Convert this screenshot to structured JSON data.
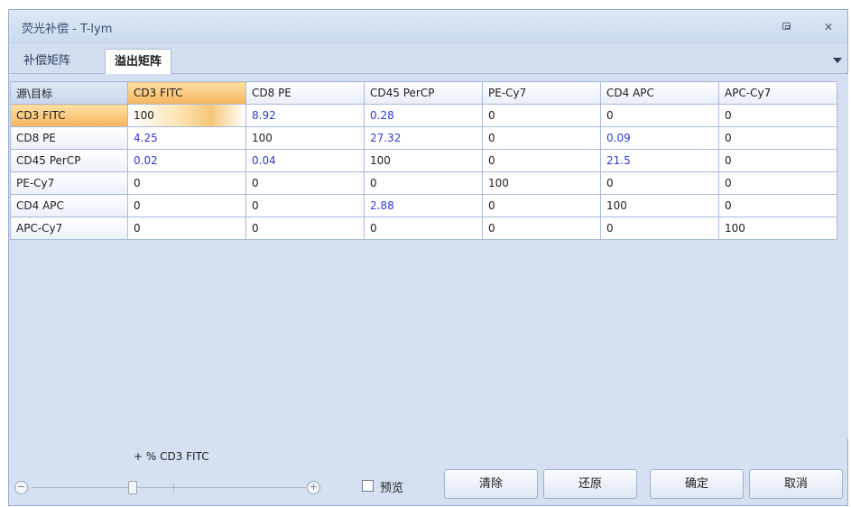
{
  "window": {
    "title": "荧光补偿 - T-lym"
  },
  "tabs": [
    {
      "label": "补偿矩阵"
    },
    {
      "label": "溢出矩阵"
    }
  ],
  "grid": {
    "corner": "源\\目标",
    "columns": [
      "CD3 FITC",
      "CD8 PE",
      "CD45 PerCP",
      "PE-Cy7",
      "CD4 APC",
      "APC-Cy7"
    ],
    "rows": [
      {
        "label": "CD3 FITC",
        "values": [
          "100",
          "8.92",
          "0.28",
          "0",
          "0",
          "0"
        ]
      },
      {
        "label": "CD8 PE",
        "values": [
          "4.25",
          "100",
          "27.32",
          "0",
          "0.09",
          "0"
        ]
      },
      {
        "label": "CD45 PerCP",
        "values": [
          "0.02",
          "0.04",
          "100",
          "0",
          "21.5",
          "0"
        ]
      },
      {
        "label": "PE-Cy7",
        "values": [
          "0",
          "0",
          "0",
          "100",
          "0",
          "0"
        ]
      },
      {
        "label": "CD4 APC",
        "values": [
          "0",
          "0",
          "2.88",
          "0",
          "100",
          "0"
        ]
      },
      {
        "label": "APC-Cy7",
        "values": [
          "0",
          "0",
          "0",
          "0",
          "0",
          "100"
        ]
      }
    ]
  },
  "slider": {
    "label": "+ % CD3 FITC",
    "minus": "−",
    "plus": "+"
  },
  "preview": {
    "label": "预览",
    "checked": false
  },
  "buttons": {
    "clear": "清除",
    "restore": "还原",
    "ok": "确定",
    "cancel": "取消"
  },
  "colors": {
    "offdiag_nonzero": "#2f3bd3",
    "selection": "#f6b45d",
    "background": "#d5e1f2"
  }
}
